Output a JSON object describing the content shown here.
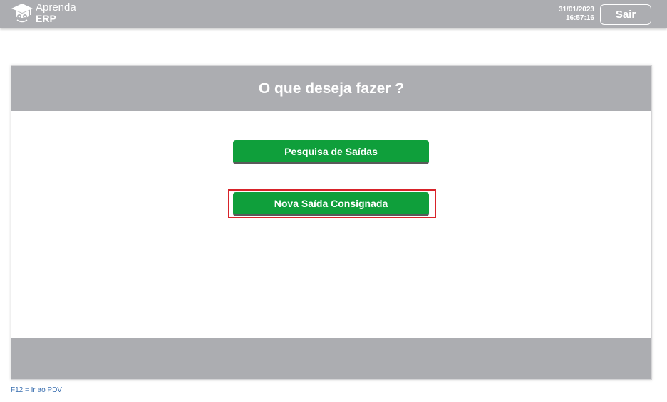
{
  "header": {
    "logo_line1": "Aprenda",
    "logo_line2": "ERP",
    "date": "31/01/2023",
    "time": "16:57:16",
    "exit_label": "Sair"
  },
  "main": {
    "title": "O que deseja fazer ?",
    "buttons": [
      {
        "label": "Pesquisa de Saídas"
      },
      {
        "label": "Nova Saída Consignada"
      }
    ]
  },
  "footer": {
    "hint": "F12 = Ir ao PDV"
  },
  "colors": {
    "bar_gray": "#acadb1",
    "button_green": "#0f9f3b",
    "highlight_red": "#d8232a",
    "hint_blue": "#3a6fb0"
  },
  "icons": {
    "logo": "graduation-cap-owl-icon"
  }
}
